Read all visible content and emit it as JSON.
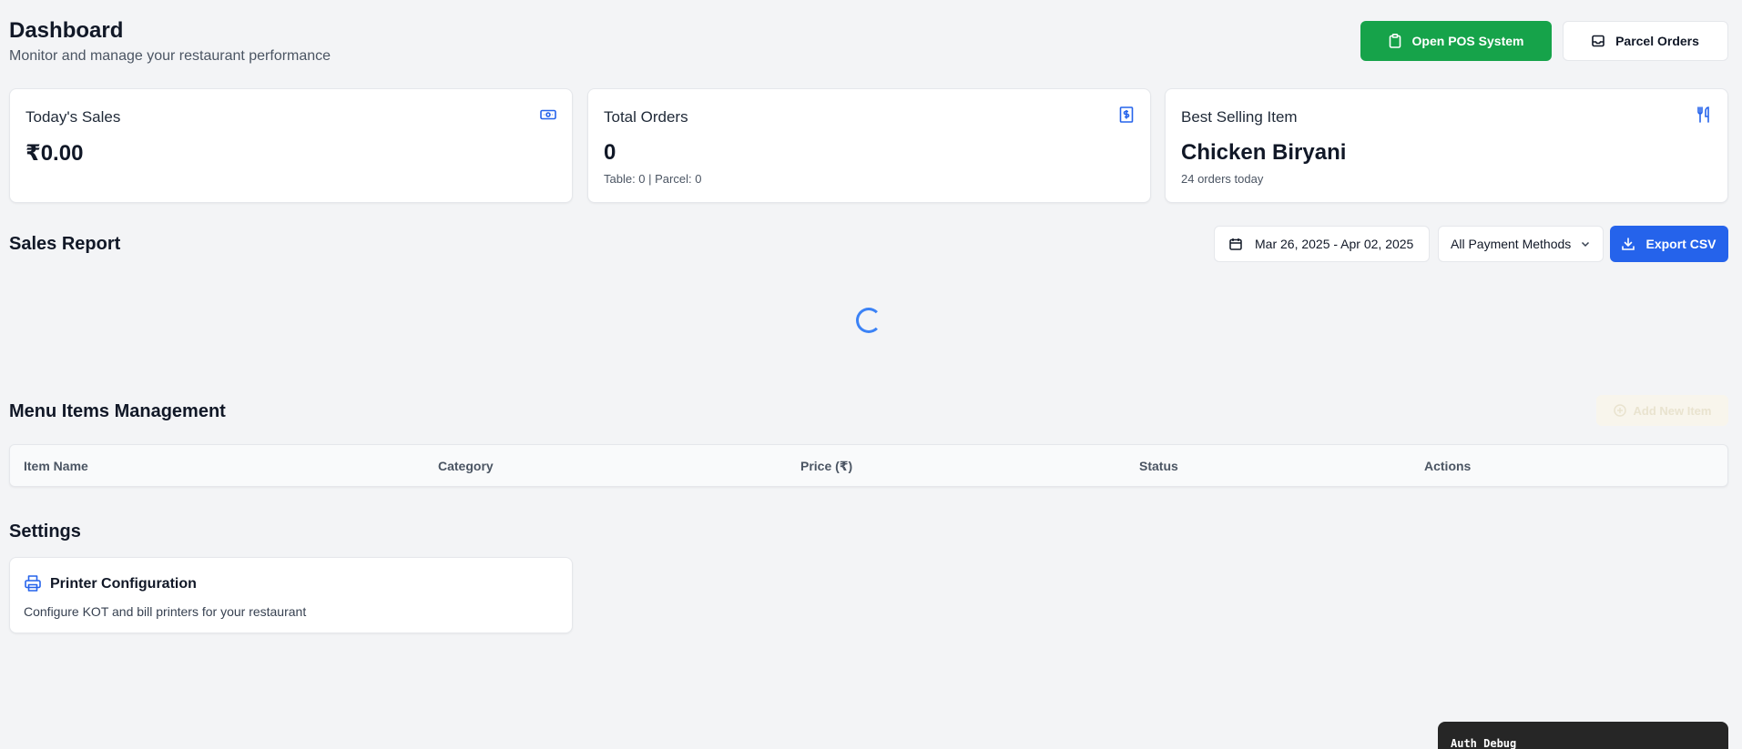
{
  "header": {
    "title": "Dashboard",
    "subtitle": "Monitor and manage your restaurant performance",
    "pos_button_label": "Open POS System",
    "parcel_button_label": "Parcel Orders"
  },
  "stats": {
    "sales": {
      "title": "Today's Sales",
      "value": "₹0.00",
      "icon": "banknote-icon"
    },
    "orders": {
      "title": "Total Orders",
      "value": "0",
      "sub": "Table: 0 | Parcel: 0",
      "icon": "receipt-dollar-icon"
    },
    "best": {
      "title": "Best Selling Item",
      "value": "Chicken Biryani",
      "sub": "24 orders today",
      "icon": "utensils-icon"
    }
  },
  "sales_report": {
    "title": "Sales Report",
    "date_range": "Mar 26, 2025 - Apr 02, 2025",
    "payment_filter": "All Payment Methods",
    "export_label": "Export CSV",
    "loading": true
  },
  "menu_items": {
    "title": "Menu Items Management",
    "add_label": "Add New Item",
    "columns": [
      "Item Name",
      "Category",
      "Price (₹)",
      "Status",
      "Actions"
    ]
  },
  "settings": {
    "title": "Settings",
    "printer": {
      "title": "Printer Configuration",
      "description": "Configure KOT and bill printers for your restaurant"
    }
  },
  "debug": {
    "label": "Auth Debug"
  },
  "colors": {
    "background": "#f3f4f6",
    "success": "#16a34a",
    "primary": "#2563eb",
    "icon_blue": "#2563eb",
    "debug_panel": "#262626"
  }
}
